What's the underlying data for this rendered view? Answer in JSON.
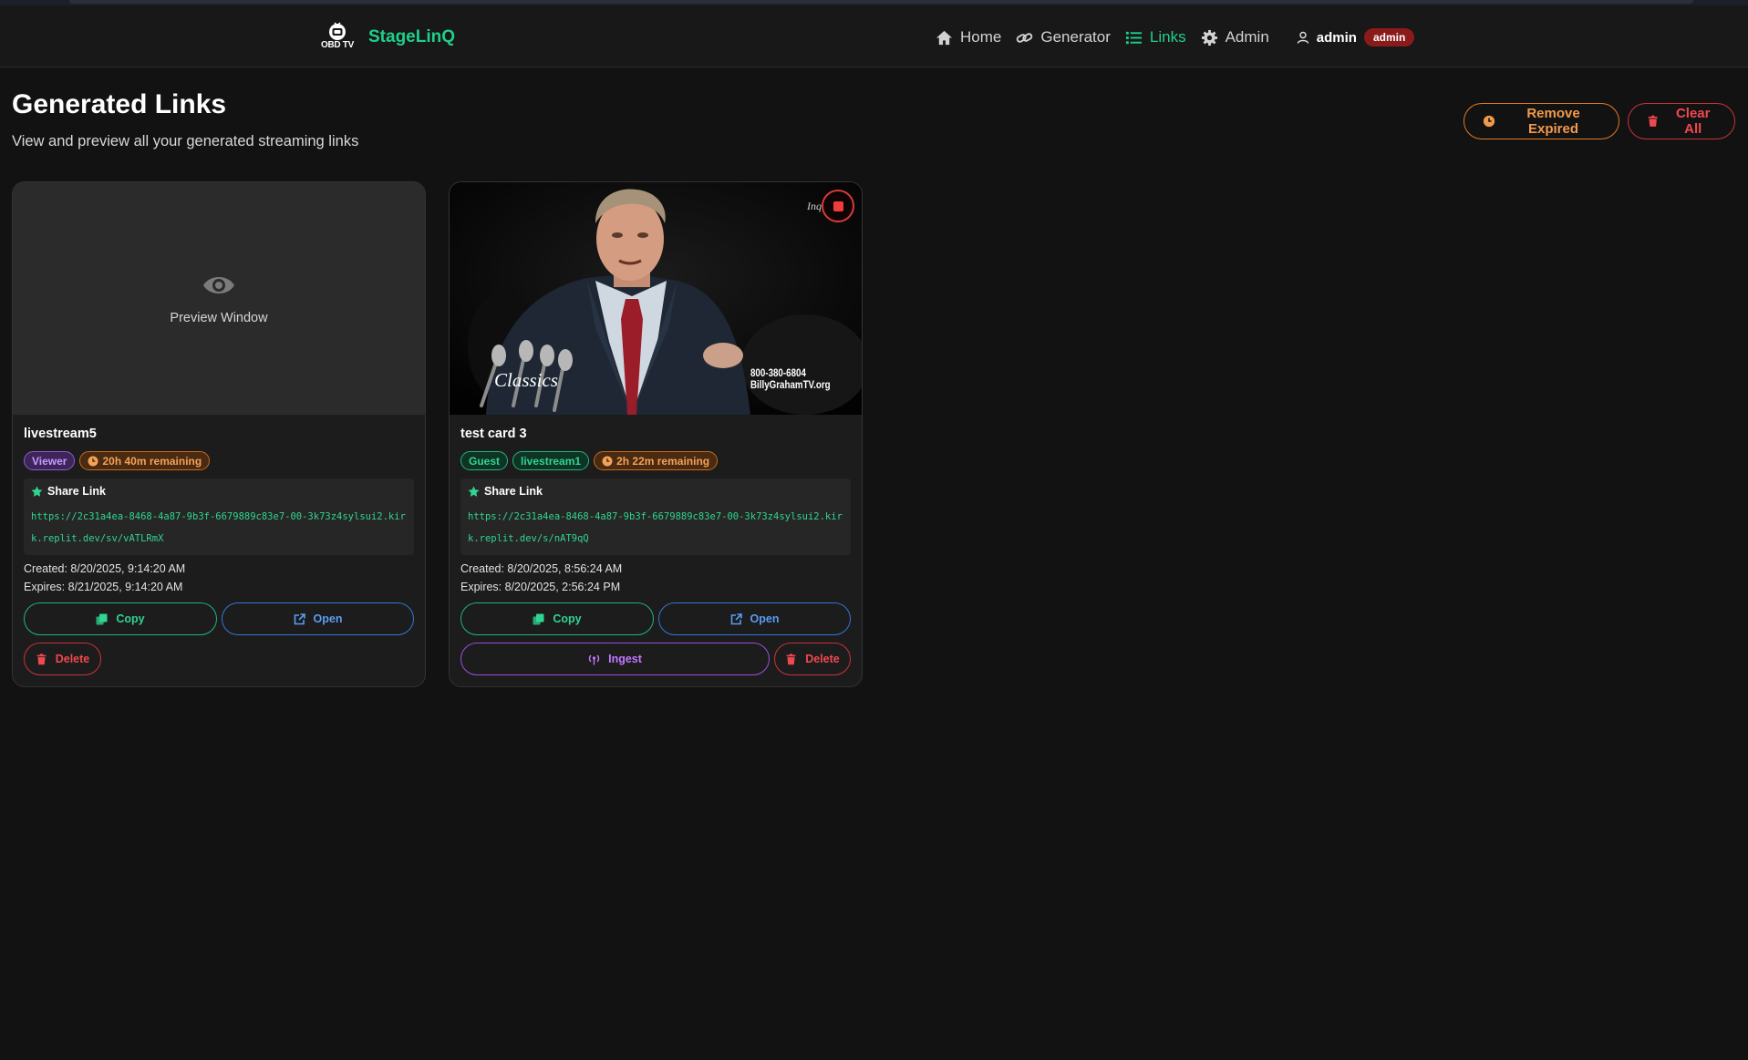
{
  "brand": {
    "logo_text": "OBD TV",
    "name": "StageLinQ"
  },
  "nav": {
    "items": [
      {
        "label": "Home",
        "icon": "home-icon",
        "active": false
      },
      {
        "label": "Generator",
        "icon": "link-icon",
        "active": false
      },
      {
        "label": "Links",
        "icon": "list-icon",
        "active": true
      },
      {
        "label": "Admin",
        "icon": "gear-icon",
        "active": false
      }
    ],
    "user": {
      "name": "admin",
      "role": "admin"
    }
  },
  "page": {
    "title": "Generated Links",
    "subtitle": "View and preview all your generated streaming links",
    "remove_expired_label": "Remove Expired",
    "clear_all_label": "Clear All"
  },
  "cards": [
    {
      "preview_label": "Preview Window",
      "title": "livestream5",
      "badges": [
        {
          "label": "Viewer",
          "kind": "viewer"
        },
        {
          "label": "20h 40m remaining",
          "kind": "time"
        }
      ],
      "share_label": "Share Link",
      "share_url": "https://2c31a4ea-8468-4a87-9b3f-6679889c83e7-00-3k73z4sylsui2.kirk.replit.dev/sv/vATLRmX",
      "created": "Created: 8/20/2025, 9:14:20 AM",
      "expires": "Expires: 8/21/2025, 9:14:20 AM",
      "copy_label": "Copy",
      "open_label": "Open",
      "delete_label": "Delete"
    },
    {
      "video": {
        "overlay_phone": "800-380-6804",
        "overlay_site": "BillyGrahamTV.org",
        "overlay_brand": "Classics"
      },
      "title": "test card 3",
      "badges": [
        {
          "label": "Guest",
          "kind": "guest"
        },
        {
          "label": "livestream1",
          "kind": "stream"
        },
        {
          "label": "2h 22m remaining",
          "kind": "time"
        }
      ],
      "share_label": "Share Link",
      "share_url": "https://2c31a4ea-8468-4a87-9b3f-6679889c83e7-00-3k73z4sylsui2.kirk.replit.dev/s/nAT9qQ",
      "created": "Created: 8/20/2025, 8:56:24 AM",
      "expires": "Expires: 8/20/2025, 2:56:24 PM",
      "copy_label": "Copy",
      "open_label": "Open",
      "ingest_label": "Ingest",
      "delete_label": "Delete"
    }
  ],
  "colors": {
    "accent_green": "#1fcf8a",
    "orange": "#e07b25",
    "red": "#f0484f",
    "blue": "#5b9cf2",
    "purple": "#c079ff",
    "background": "#121212"
  }
}
